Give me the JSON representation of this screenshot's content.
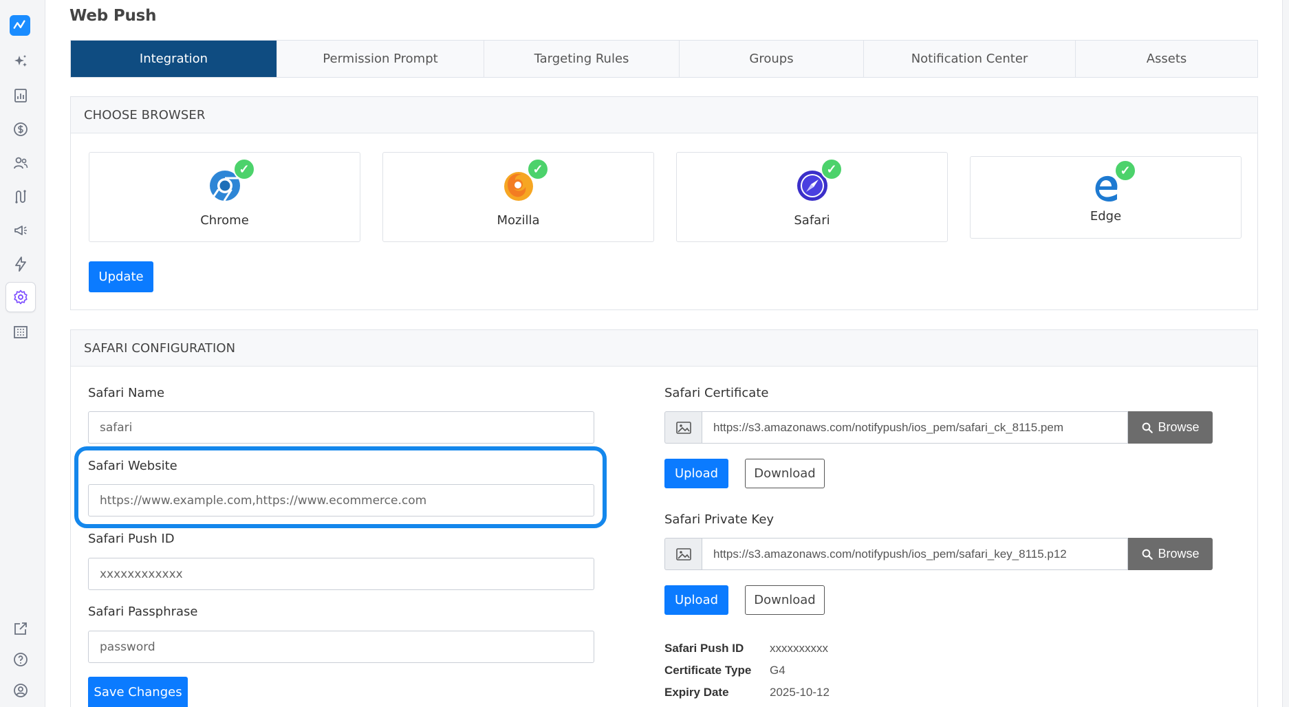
{
  "page": {
    "title": "Web Push"
  },
  "tabs": [
    {
      "label": "Integration",
      "active": true
    },
    {
      "label": "Permission Prompt",
      "active": false
    },
    {
      "label": "Targeting Rules",
      "active": false
    },
    {
      "label": "Groups",
      "active": false
    },
    {
      "label": "Notification Center",
      "active": false
    },
    {
      "label": "Assets",
      "active": false
    }
  ],
  "choose_browser": {
    "heading": "CHOOSE BROWSER",
    "browsers": [
      {
        "name": "Chrome",
        "icon": "chrome-icon",
        "checked": true
      },
      {
        "name": "Mozilla",
        "icon": "firefox-icon",
        "checked": true
      },
      {
        "name": "Safari",
        "icon": "safari-icon",
        "checked": true
      },
      {
        "name": "Edge",
        "icon": "edge-icon",
        "checked": true
      }
    ],
    "check_glyph": "✓",
    "update_label": "Update"
  },
  "safari_config": {
    "heading": "SAFARI CONFIGURATION",
    "safari_name": {
      "label": "Safari Name",
      "placeholder": "safari"
    },
    "safari_website": {
      "label": "Safari Website",
      "placeholder": "https://www.example.com,https://www.ecommerce.com"
    },
    "safari_push_id": {
      "label": "Safari Push ID",
      "placeholder": "xxxxxxxxxxxx"
    },
    "safari_passphrase": {
      "label": "Safari Passphrase",
      "placeholder": "password"
    },
    "save_label": "Save Changes",
    "certificate": {
      "label": "Safari Certificate",
      "value": "https://s3.amazonaws.com/notifypush/ios_pem/safari_ck_8115.pem",
      "browse_label": "Browse",
      "upload_label": "Upload",
      "download_label": "Download"
    },
    "private_key": {
      "label": "Safari Private Key",
      "value": "https://s3.amazonaws.com/notifypush/ios_pem/safari_key_8115.p12",
      "browse_label": "Browse",
      "upload_label": "Upload",
      "download_label": "Download"
    },
    "info": [
      {
        "key": "Safari Push ID",
        "value": "xxxxxxxxxx"
      },
      {
        "key": "Certificate Type",
        "value": "G4"
      },
      {
        "key": "Expiry Date",
        "value": "2025-10-12"
      }
    ]
  },
  "colors": {
    "accent": "#0b7bff",
    "active_tab": "#0f4c81",
    "check": "#4cd26b",
    "highlight": "#1487ec",
    "browse_button": "#6c6c6c"
  },
  "sidebar": {
    "items": [
      {
        "icon": "logo-icon"
      },
      {
        "icon": "sparkles-icon"
      },
      {
        "icon": "report-chart-icon"
      },
      {
        "icon": "dollar-icon"
      },
      {
        "icon": "users-icon"
      },
      {
        "icon": "journey-icon"
      },
      {
        "icon": "megaphone-icon"
      },
      {
        "icon": "lightning-icon"
      },
      {
        "icon": "gear-icon",
        "active": true
      },
      {
        "icon": "building-icon"
      },
      {
        "icon": "external-link-icon"
      },
      {
        "icon": "help-icon"
      },
      {
        "icon": "account-icon"
      }
    ]
  }
}
